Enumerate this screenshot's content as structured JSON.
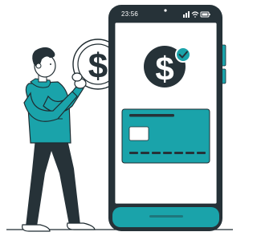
{
  "phone": {
    "status_time": "23:56",
    "icons": [
      "signal-icon",
      "wifi-icon",
      "battery-icon"
    ]
  },
  "screen": {
    "badge_icon": "dollar-coin-icon",
    "badge_check_icon": "checkmark-icon",
    "card_icon": "credit-card-icon"
  },
  "person": {
    "holding_icon": "dollar-coin-icon"
  },
  "colors": {
    "accent": "#1aa3aa",
    "dark": "#263238",
    "outline": "#1f2b30",
    "white": "#ffffff"
  }
}
